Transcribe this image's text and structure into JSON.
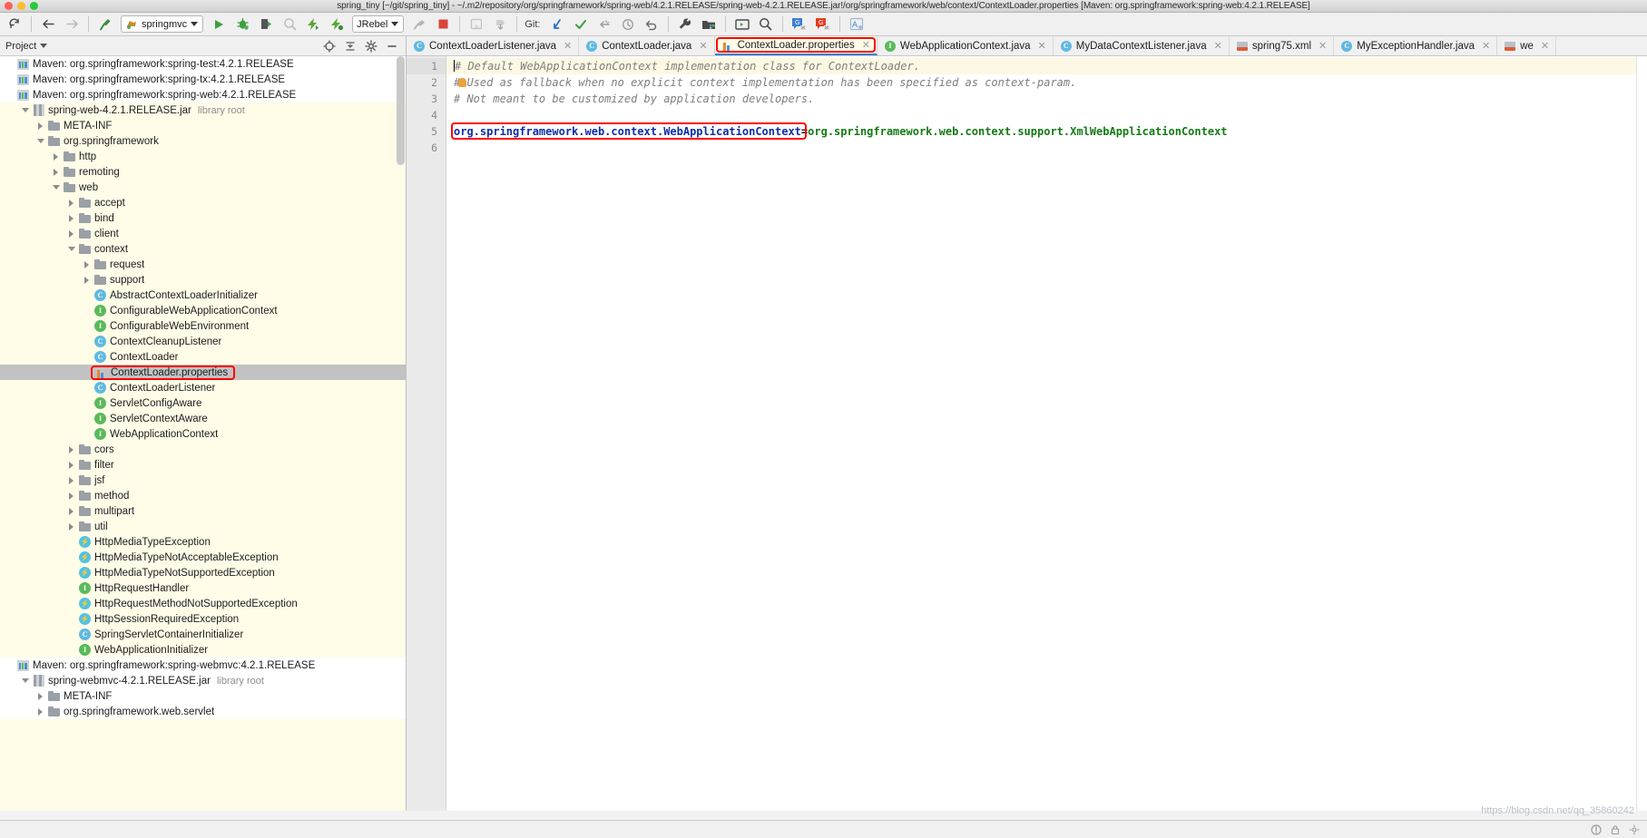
{
  "window": {
    "title": "spring_tiny [~/git/spring_tiny] - ~/.m2/repository/org/springframework/spring-web/4.2.1.RELEASE/spring-web-4.2.1.RELEASE.jar!/org/springframework/web/context/ContextLoader.properties [Maven: org.springframework:spring-web:4.2.1.RELEASE]"
  },
  "toolbar": {
    "sync_icon": "sync-icon",
    "back_icon": "back-arrow-icon",
    "forward_icon": "forward-arrow-icon",
    "build_icon": "build-hammer-icon",
    "run_config": "springmvc",
    "run_icon": "run-icon",
    "debug_icon": "debug-icon",
    "run_coverage_icon": "run-with-coverage-icon",
    "profile_icon": "profile-icon",
    "jrebel_run_icon": "jrebel-run-icon",
    "jrebel_debug_icon": "jrebel-debug-icon",
    "jrebel_label": "JRebel",
    "stop_icon": "stop-icon",
    "deploy_icon": "deploy-icon",
    "update_icon": "update-app-icon",
    "git_label": "Git:",
    "git_update_icon": "vcs-update-icon",
    "git_commit_icon": "vcs-commit-icon",
    "git_push_icon": "vcs-push-icon",
    "git_history_icon": "vcs-history-icon",
    "git_revert_icon": "vcs-revert-icon",
    "settings_icon": "wrench-settings-icon",
    "project-structure_icon": "project-structure-icon",
    "terminal_icon": "terminal-icon",
    "search_icon": "search-everywhere-icon",
    "translate_blue_icon": "translate-blue-icon",
    "translate_red_icon": "translate-red-icon",
    "font_icon": "font-tool-icon"
  },
  "project_panel": {
    "title": "Project",
    "dropdown_icon": "chevron-down-icon",
    "locate_icon": "locate-target-icon",
    "collapse_icon": "collapse-all-icon",
    "settings_icon": "gear-icon",
    "hide_icon": "hide-panel-icon",
    "tree": [
      {
        "label": "Maven: org.springframework:spring-test:4.2.1.RELEASE",
        "indent": 0,
        "icon": "maven-icon",
        "arrow": "none",
        "bg": "white",
        "clipped": true
      },
      {
        "label": "Maven: org.springframework:spring-tx:4.2.1.RELEASE",
        "indent": 0,
        "icon": "maven-icon",
        "arrow": "none",
        "bg": "white"
      },
      {
        "label": "Maven: org.springframework:spring-web:4.2.1.RELEASE",
        "indent": 0,
        "icon": "maven-icon",
        "arrow": "none",
        "bg": "white"
      },
      {
        "label": "spring-web-4.2.1.RELEASE.jar",
        "sub": "library root",
        "indent": 1,
        "icon": "jar-icon",
        "arrow": "down"
      },
      {
        "label": "META-INF",
        "indent": 2,
        "icon": "folder-icon",
        "arrow": "right"
      },
      {
        "label": "org.springframework",
        "indent": 2,
        "icon": "folder-icon",
        "arrow": "down"
      },
      {
        "label": "http",
        "indent": 3,
        "icon": "folder-icon",
        "arrow": "right"
      },
      {
        "label": "remoting",
        "indent": 3,
        "icon": "folder-icon",
        "arrow": "right"
      },
      {
        "label": "web",
        "indent": 3,
        "icon": "folder-icon",
        "arrow": "down"
      },
      {
        "label": "accept",
        "indent": 4,
        "icon": "folder-icon",
        "arrow": "right"
      },
      {
        "label": "bind",
        "indent": 4,
        "icon": "folder-icon",
        "arrow": "right"
      },
      {
        "label": "client",
        "indent": 4,
        "icon": "folder-icon",
        "arrow": "right"
      },
      {
        "label": "context",
        "indent": 4,
        "icon": "folder-icon",
        "arrow": "down"
      },
      {
        "label": "request",
        "indent": 5,
        "icon": "folder-icon",
        "arrow": "right"
      },
      {
        "label": "support",
        "indent": 5,
        "icon": "folder-icon",
        "arrow": "right"
      },
      {
        "label": "AbstractContextLoaderInitializer",
        "indent": 5,
        "icon": "class-icon",
        "arrow": "none"
      },
      {
        "label": "ConfigurableWebApplicationContext",
        "indent": 5,
        "icon": "interface-icon",
        "arrow": "none"
      },
      {
        "label": "ConfigurableWebEnvironment",
        "indent": 5,
        "icon": "interface-icon",
        "arrow": "none"
      },
      {
        "label": "ContextCleanupListener",
        "indent": 5,
        "icon": "class-icon",
        "arrow": "none"
      },
      {
        "label": "ContextLoader",
        "indent": 5,
        "icon": "class-icon",
        "arrow": "none"
      },
      {
        "label": "ContextLoader.properties",
        "indent": 5,
        "icon": "properties-icon",
        "arrow": "none",
        "selected": true,
        "highlight": true
      },
      {
        "label": "ContextLoaderListener",
        "indent": 5,
        "icon": "class-icon",
        "arrow": "none"
      },
      {
        "label": "ServletConfigAware",
        "indent": 5,
        "icon": "interface-icon",
        "arrow": "none"
      },
      {
        "label": "ServletContextAware",
        "indent": 5,
        "icon": "interface-icon",
        "arrow": "none"
      },
      {
        "label": "WebApplicationContext",
        "indent": 5,
        "icon": "interface-icon",
        "arrow": "none"
      },
      {
        "label": "cors",
        "indent": 4,
        "icon": "folder-icon",
        "arrow": "right"
      },
      {
        "label": "filter",
        "indent": 4,
        "icon": "folder-icon",
        "arrow": "right"
      },
      {
        "label": "jsf",
        "indent": 4,
        "icon": "folder-icon",
        "arrow": "right"
      },
      {
        "label": "method",
        "indent": 4,
        "icon": "folder-icon",
        "arrow": "right"
      },
      {
        "label": "multipart",
        "indent": 4,
        "icon": "folder-icon",
        "arrow": "right"
      },
      {
        "label": "util",
        "indent": 4,
        "icon": "folder-icon",
        "arrow": "right"
      },
      {
        "label": "HttpMediaTypeException",
        "indent": 4,
        "icon": "exception-icon",
        "arrow": "none"
      },
      {
        "label": "HttpMediaTypeNotAcceptableException",
        "indent": 4,
        "icon": "exception-icon",
        "arrow": "none"
      },
      {
        "label": "HttpMediaTypeNotSupportedException",
        "indent": 4,
        "icon": "exception-icon",
        "arrow": "none"
      },
      {
        "label": "HttpRequestHandler",
        "indent": 4,
        "icon": "interface-icon",
        "arrow": "none"
      },
      {
        "label": "HttpRequestMethodNotSupportedException",
        "indent": 4,
        "icon": "exception-icon",
        "arrow": "none"
      },
      {
        "label": "HttpSessionRequiredException",
        "indent": 4,
        "icon": "exception-icon",
        "arrow": "none"
      },
      {
        "label": "SpringServletContainerInitializer",
        "indent": 4,
        "icon": "class-icon",
        "arrow": "none"
      },
      {
        "label": "WebApplicationInitializer",
        "indent": 4,
        "icon": "interface-icon",
        "arrow": "none"
      },
      {
        "label": "Maven: org.springframework:spring-webmvc:4.2.1.RELEASE",
        "indent": 0,
        "icon": "maven-icon",
        "arrow": "none",
        "bg": "white"
      },
      {
        "label": "spring-webmvc-4.2.1.RELEASE.jar",
        "sub": "library root",
        "indent": 1,
        "icon": "jar-icon",
        "arrow": "down",
        "bg": "white"
      },
      {
        "label": "META-INF",
        "indent": 2,
        "icon": "folder-icon",
        "arrow": "right",
        "bg": "white"
      },
      {
        "label": "org.springframework.web.servlet",
        "indent": 2,
        "icon": "folder-icon",
        "arrow": "right",
        "bg": "white",
        "clipped": true
      }
    ]
  },
  "editor_tabs": [
    {
      "label": "ContextLoaderListener.java",
      "icon": "class-icon",
      "active": false,
      "close_icon": "close-icon"
    },
    {
      "label": "ContextLoader.java",
      "icon": "class-icon",
      "active": false,
      "close_icon": "close-icon"
    },
    {
      "label": "ContextLoader.properties",
      "icon": "properties-icon",
      "active": true,
      "highlight": true,
      "close_icon": "close-icon"
    },
    {
      "label": "WebApplicationContext.java",
      "icon": "interface-icon",
      "active": false,
      "close_icon": "close-icon"
    },
    {
      "label": "MyDataContextListener.java",
      "icon": "class-icon",
      "active": false,
      "close_icon": "close-icon"
    },
    {
      "label": "spring75.xml",
      "icon": "xml-icon",
      "active": false,
      "close_icon": "close-icon"
    },
    {
      "label": "MyExceptionHandler.java",
      "icon": "class-icon",
      "active": false,
      "close_icon": "close-icon"
    },
    {
      "label": "we",
      "icon": "xml-icon",
      "active": false,
      "close_icon": "close-icon",
      "clipped": true
    }
  ],
  "editor": {
    "line_numbers": [
      "1",
      "2",
      "3",
      "4",
      "5",
      "6"
    ],
    "lines": [
      {
        "n": 1,
        "type": "comment",
        "text": "# Default WebApplicationContext implementation class for ContextLoader.",
        "caret": true,
        "highlight": true
      },
      {
        "n": 2,
        "type": "comment",
        "text": "# Used as fallback when no explicit context implementation has been specified as context-param.",
        "bulb": true
      },
      {
        "n": 3,
        "type": "comment",
        "text": "# Not meant to be customized by application developers."
      },
      {
        "n": 4,
        "type": "blank",
        "text": ""
      },
      {
        "n": 5,
        "type": "property",
        "key": "org.springframework.web.context.WebApplicationContext",
        "sep": "=",
        "value": "org.springframework.web.context.support.XmlWebApplicationContext",
        "highlight_key": true
      },
      {
        "n": 6,
        "type": "blank",
        "text": ""
      }
    ]
  },
  "statusbar": {
    "message": "",
    "lock_icon": "lock-icon",
    "warning_icon": "warning-icon",
    "settings_icon": "gear-icon"
  },
  "watermark": "https://blog.csdn.net/qq_35860242",
  "colors": {
    "accent_blue": "#3b7fd4",
    "highlight_red": "#ff0000",
    "editor_bg": "#ffffff",
    "tree_bg": "#fffce8",
    "selection_gray": "#c2c2c2",
    "comment_gray": "#7f7f7f",
    "key_blue": "#0e2ea8",
    "value_green": "#147a14"
  }
}
